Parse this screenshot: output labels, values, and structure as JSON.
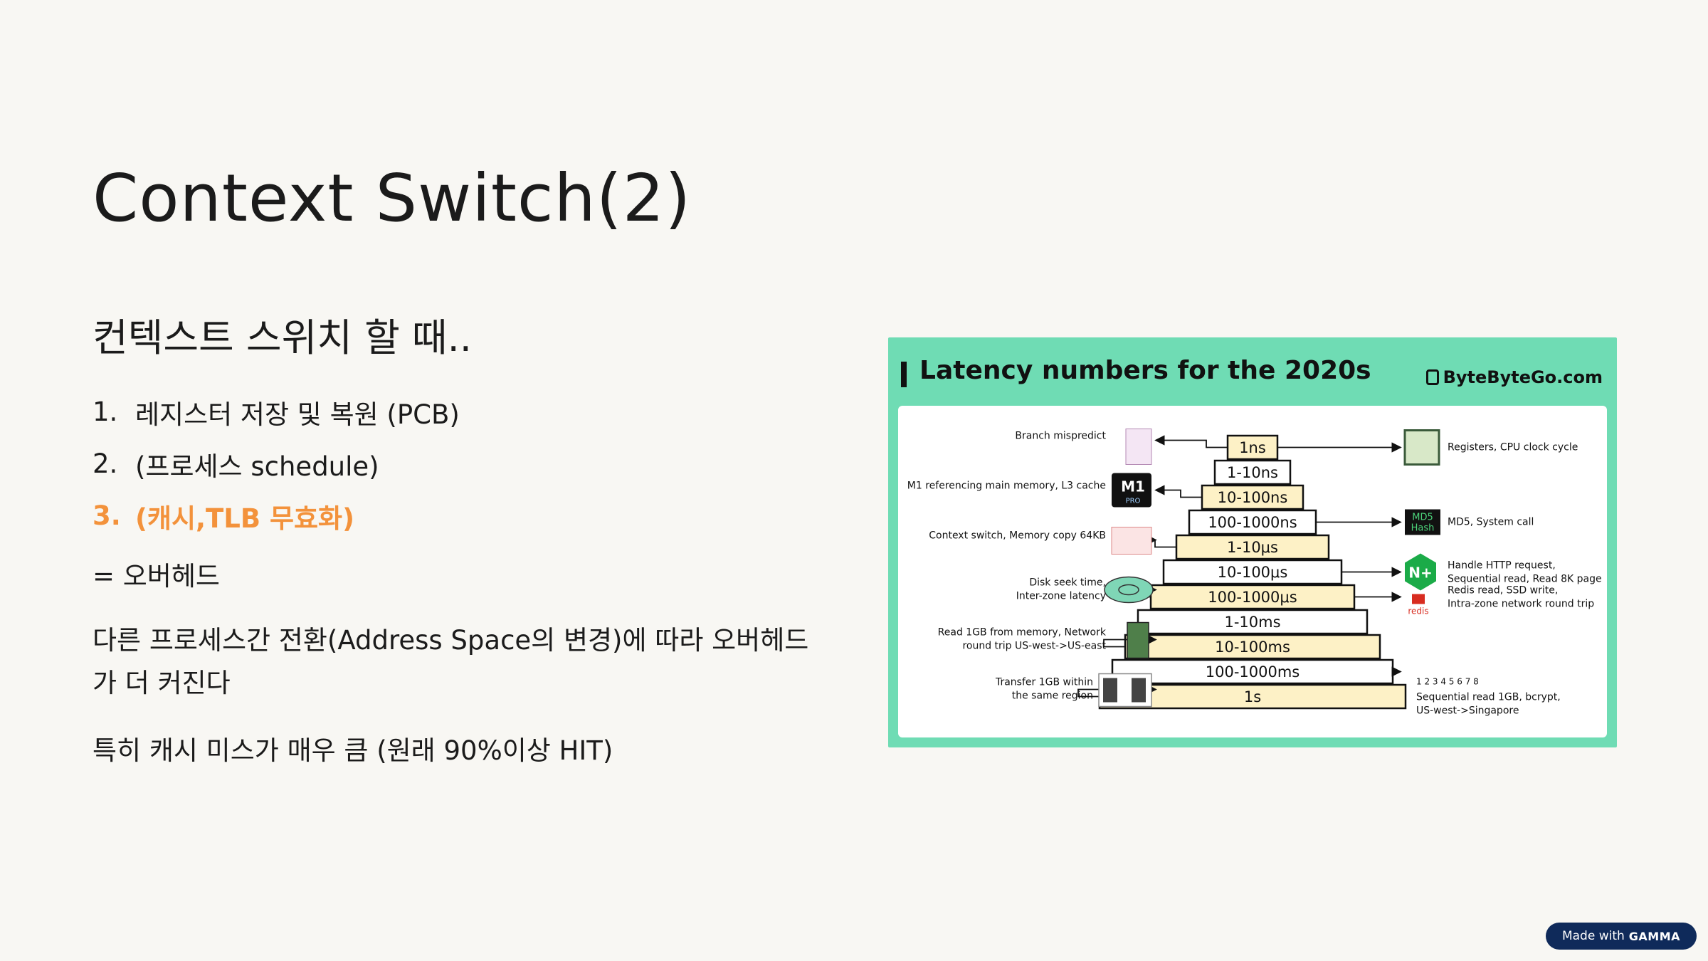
{
  "slide": {
    "title": "Context Switch(2)",
    "sub_heading": "컨텍스트 스위치 할 때..",
    "list": [
      {
        "num": "1.",
        "text": "레지스터 저장 및 복원 (PCB)"
      },
      {
        "num": "2.",
        "text": "(프로세스 schedule)"
      },
      {
        "num": "3.",
        "text": "(캐시,TLB 무효화)"
      }
    ],
    "p1": "= 오버헤드",
    "p2": "다른 프로세스간 전환(Address Space의 변경)에 따라 오버헤드가 더 커진다",
    "p3": "특히 캐시 미스가 매우 큼 (원래 90%이상 HIT)"
  },
  "figure": {
    "title": "Latency numbers for the 2020s",
    "brand": "ByteByteGo.com",
    "steps": [
      "1ns",
      "1-10ns",
      "10-100ns",
      "100-1000ns",
      "1-10μs",
      "10-100μs",
      "100-1000μs",
      "1-10ms",
      "10-100ms",
      "100-1000ms",
      "1s"
    ],
    "left_labels": [
      {
        "lines": [
          "Branch mispredict"
        ],
        "step": 0,
        "icon": "branch-icon"
      },
      {
        "lines": [
          "M1 referencing main memory, L3 cache"
        ],
        "step": 2,
        "icon": "m1-chip-icon"
      },
      {
        "lines": [
          "Context switch, Memory copy 64KB"
        ],
        "step": 4,
        "icon": "memory-copy-icon"
      },
      {
        "lines": [
          "Disk seek time,",
          "Inter-zone latency"
        ],
        "step": 6,
        "icon": "disk-icon"
      },
      {
        "lines": [
          "Read 1GB from memory, Network",
          "round trip US-west->US-east"
        ],
        "step": 8,
        "icon": "ram-stick-icon"
      },
      {
        "lines": [
          "Transfer 1GB within",
          "the same region"
        ],
        "step": 10,
        "icon": "servers-icon"
      }
    ],
    "right_labels": [
      {
        "lines": [
          "Registers, CPU clock cycle"
        ],
        "step": 0,
        "icon": "cpu-icon"
      },
      {
        "lines": [
          "MD5, System call"
        ],
        "step": 3,
        "icon": "md5-hash-icon",
        "icon_text": [
          "MD5",
          "Hash"
        ]
      },
      {
        "lines": [
          "Handle HTTP request,",
          "Sequential read, Read 8K page"
        ],
        "step": 5,
        "icon": "nginx-icon",
        "icon_text": [
          "N+"
        ]
      },
      {
        "lines": [
          "Redis read, SSD write,",
          "Intra-zone network round trip"
        ],
        "step": 6,
        "icon": "redis-icon",
        "icon_text": [
          "redis"
        ]
      },
      {
        "lines": [
          "Sequential read 1GB, bcrypt,",
          "US-west->Singapore"
        ],
        "step": 9,
        "icon": "sequence-icon",
        "icon_text": [
          "1 2 3 4 5 6 7 8"
        ]
      }
    ],
    "m1_text": "M1",
    "m1_sub": "PRO"
  },
  "badge": {
    "prefix": "Made with",
    "brand": "GAMMA"
  },
  "colors": {
    "accent": "#f3923b",
    "figure_bg": "#6fdcb4",
    "step_fill": "#fdf1c6",
    "badge_bg": "#0f2a5a"
  }
}
